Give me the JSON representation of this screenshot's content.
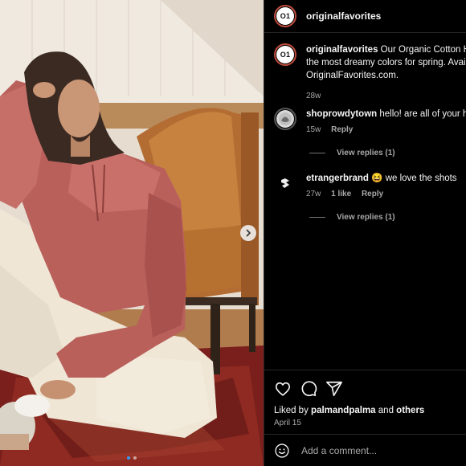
{
  "post": {
    "author": "originalfavorites",
    "avatar_text": "O1",
    "caption_text": "Our Organic Cotton H",
    "caption_line2": "the most dreamy colors for spring. Avai",
    "caption_line3": "OriginalFavorites.com.",
    "caption_time": "28w",
    "liked_by_prefix": "Liked by",
    "liked_by_user": "palmandpalma",
    "liked_by_and": "and",
    "liked_by_others": "others",
    "date": "April 15",
    "carousel_dots": 2
  },
  "comments": [
    {
      "user": "shoprowdytown",
      "text": "hello! are all of your h",
      "time": "15w",
      "reply": "Reply",
      "view_replies": "View replies (1)"
    },
    {
      "user": "etrangerbrand",
      "emoji": "😆",
      "text": "we love the shots",
      "time": "27w",
      "likes": "1 like",
      "reply": "Reply",
      "view_replies": "View replies (1)"
    }
  ],
  "composer": {
    "placeholder": "Add a comment..."
  },
  "colors": {
    "background": "#000000",
    "muted": "#a8a8a8",
    "divider": "#262626",
    "avatar_ring": "#c04d3d",
    "active_dot": "#3a9cf5"
  },
  "icons": [
    "heart-icon",
    "comment-icon",
    "share-icon",
    "emoji-icon",
    "chevron-right-icon"
  ]
}
